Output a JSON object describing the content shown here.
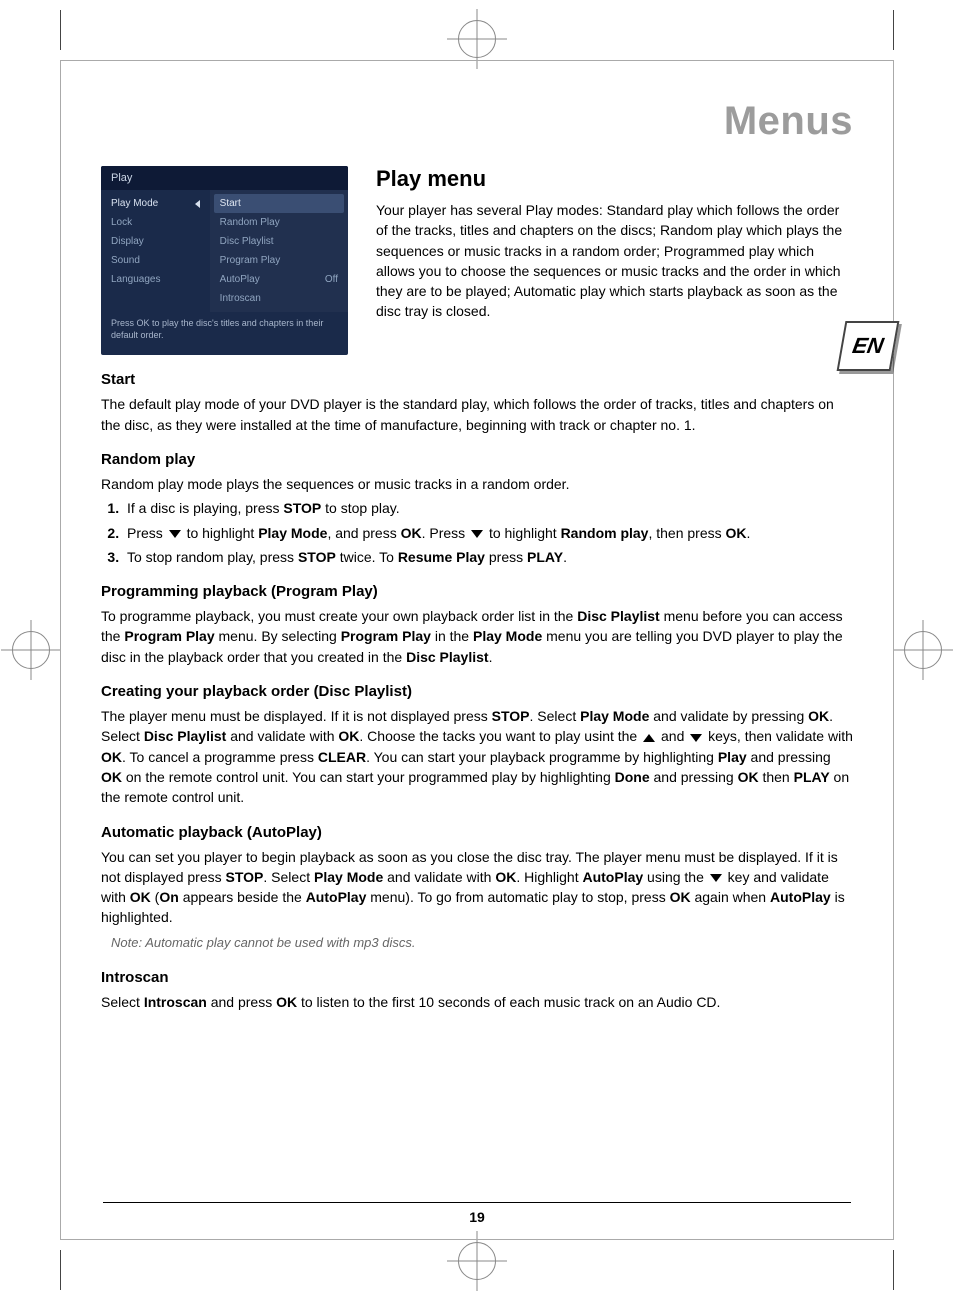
{
  "header": {
    "title": "Menus",
    "page_number": "19",
    "lang_badge": "EN"
  },
  "osd": {
    "title": "Play",
    "left_items": [
      "Play Mode",
      "Lock",
      "Display",
      "Sound",
      "Languages"
    ],
    "left_selected_index": 0,
    "right_items": [
      {
        "label": "Start",
        "value": ""
      },
      {
        "label": "Random Play",
        "value": ""
      },
      {
        "label": "Disc Playlist",
        "value": ""
      },
      {
        "label": "Program Play",
        "value": ""
      },
      {
        "label": "AutoPlay",
        "value": "Off"
      },
      {
        "label": "Introscan",
        "value": ""
      }
    ],
    "right_selected_index": 0,
    "footer": "Press OK to play the disc's titles and chapters in their default order."
  },
  "sections": {
    "play_menu": {
      "heading": "Play menu",
      "body": "Your player has several Play modes: Standard play which follows the order of the tracks, titles and chapters on the discs; Random play which plays the sequences or music tracks in a random order; Programmed play which allows you to choose the sequences or music tracks and the order in which they are to be played; Automatic play which starts playback as soon as the disc tray is closed."
    },
    "start": {
      "heading": "Start",
      "body": "The default play mode of your DVD player is the standard play, which follows the order of tracks, titles and chapters on the disc, as they were installed at the time of manufacture, beginning with track or chapter no. 1."
    },
    "random": {
      "heading": "Random play",
      "intro": "Random play mode plays the sequences or music tracks in a random order.",
      "steps": {
        "s1_a": "If a disc is playing, press ",
        "s1_b": " to stop play.",
        "s2_a": "Press ",
        "s2_b": " to highlight ",
        "s2_c": ", and press ",
        "s2_d": ". Press ",
        "s2_e": " to highlight ",
        "s2_f": ", then press ",
        "s2_g": ".",
        "s3_a": "To stop random play, press ",
        "s3_b": " twice. To ",
        "s3_c": " press ",
        "s3_d": "."
      },
      "bold": {
        "stop": "STOP",
        "play_mode": "Play Mode",
        "ok": "OK",
        "random_play": "Random play",
        "resume_play": "Resume Play",
        "play": "PLAY"
      }
    },
    "program": {
      "heading": "Programming playback (Program Play)",
      "p1": "To programme playback, you must create your own playback order list in the ",
      "p2": " menu before you can access the ",
      "p3": " menu. By selecting ",
      "p4": " in the ",
      "p5": " menu you are telling you DVD player to play the disc in the playback order that you created in the ",
      "p6": ".",
      "bold": {
        "disc_playlist": "Disc Playlist",
        "program_play": "Program Play",
        "play_mode": "Play Mode"
      }
    },
    "creating": {
      "heading": "Creating your playback order (Disc Playlist)",
      "p1": "The player menu must be displayed. If it is not displayed press ",
      "p2": ". Select ",
      "p3": " and validate by pressing ",
      "p4": ". Select ",
      "p5": " and validate with ",
      "p6": ". Choose the tacks you want to play usint the ",
      "p7": " and ",
      "p8": " keys, then validate with ",
      "p9": ". To cancel a programme press ",
      "p10": ". You can start your playback programme by highlighting ",
      "p11": " and pressing ",
      "p12": " on the remote control unit. You can start your programmed play by highlighting ",
      "p13": " and pressing ",
      "p14": " then ",
      "p15": " on the remote control unit.",
      "bold": {
        "stop": "STOP",
        "play_mode": "Play Mode",
        "ok": "OK",
        "disc_playlist": "Disc Playlist",
        "clear": "CLEAR",
        "play": "Play",
        "done": "Done",
        "PLAY": "PLAY"
      }
    },
    "autoplay": {
      "heading": "Automatic playback (AutoPlay)",
      "p1": "You can set you player to begin playback as soon as you close the disc tray. The player menu must be displayed. If it is not displayed press ",
      "p2": ". Select ",
      "p3": " and validate with ",
      "p4": ". Highlight ",
      "p5": " using the ",
      "p6": " key and validate with ",
      "p7": " (",
      "p8": " appears beside the ",
      "p9": " menu). To go from automatic play to stop, press ",
      "p10": " again when ",
      "p11": " is highlighted.",
      "bold": {
        "stop": "STOP",
        "play_mode": "Play Mode",
        "ok": "OK",
        "autoplay": "AutoPlay",
        "on": "On"
      },
      "note": "Note: Automatic play cannot be used with mp3 discs."
    },
    "introscan": {
      "heading": "Introscan",
      "p1": "Select ",
      "p2": " and press ",
      "p3": " to listen to the first 10 seconds of each music track on an Audio CD.",
      "bold": {
        "introscan": "Introscan",
        "ok": "OK"
      }
    }
  }
}
